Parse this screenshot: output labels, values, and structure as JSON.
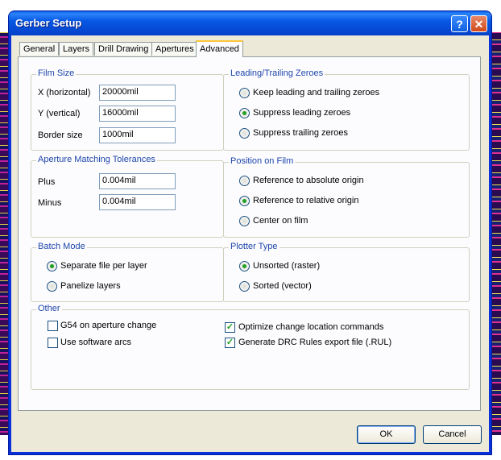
{
  "window": {
    "title": "Gerber Setup",
    "help_label": "?",
    "close_label": "✕"
  },
  "tabs": [
    {
      "label": "General",
      "active": false
    },
    {
      "label": "Layers",
      "active": false
    },
    {
      "label": "Drill Drawing",
      "active": false
    },
    {
      "label": "Apertures",
      "active": false
    },
    {
      "label": "Advanced",
      "active": true
    }
  ],
  "film_size": {
    "title": "Film Size",
    "x_label": "X (horizontal)",
    "x_value": "20000mil",
    "y_label": "Y (vertical)",
    "y_value": "16000mil",
    "border_label": "Border size",
    "border_value": "1000mil"
  },
  "leading_trailing": {
    "title": "Leading/Trailing Zeroes",
    "options": [
      {
        "label": "Keep leading and trailing zeroes",
        "selected": false
      },
      {
        "label": "Suppress leading zeroes",
        "selected": true
      },
      {
        "label": "Suppress trailing zeroes",
        "selected": false
      }
    ]
  },
  "aperture_tolerances": {
    "title": "Aperture Matching Tolerances",
    "plus_label": "Plus",
    "plus_value": "0.004mil",
    "minus_label": "Minus",
    "minus_value": "0.004mil"
  },
  "position_on_film": {
    "title": "Position on Film",
    "options": [
      {
        "label": "Reference to absolute origin",
        "selected": false
      },
      {
        "label": "Reference to relative origin",
        "selected": true
      },
      {
        "label": "Center on film",
        "selected": false
      }
    ]
  },
  "batch_mode": {
    "title": "Batch Mode",
    "options": [
      {
        "label": "Separate file per layer",
        "selected": true
      },
      {
        "label": "Panelize layers",
        "selected": false
      }
    ]
  },
  "plotter_type": {
    "title": "Plotter Type",
    "options": [
      {
        "label": "Unsorted (raster)",
        "selected": true
      },
      {
        "label": "Sorted (vector)",
        "selected": false
      }
    ]
  },
  "other": {
    "title": "Other",
    "g54_label": "G54 on aperture change",
    "g54_checked": false,
    "software_arcs_label": "Use software arcs",
    "software_arcs_checked": false,
    "optimize_label": "Optimize change location commands",
    "optimize_checked": true,
    "drc_label": "Generate DRC Rules export file (.RUL)",
    "drc_checked": true
  },
  "buttons": {
    "ok_label": "OK",
    "cancel_label": "Cancel"
  },
  "check_mark": "✓"
}
